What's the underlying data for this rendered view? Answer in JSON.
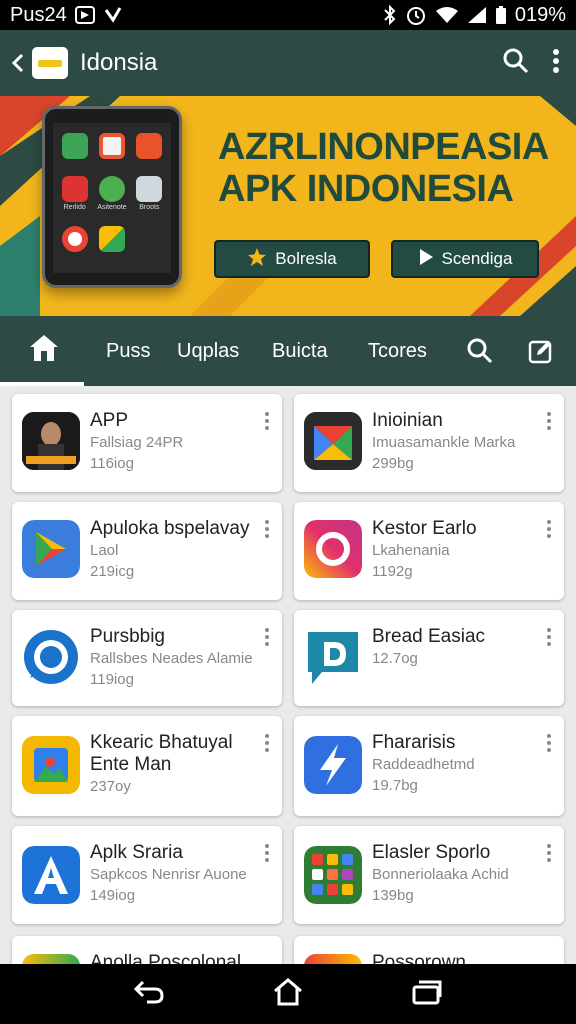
{
  "status_bar": {
    "carrier": "Pus24",
    "battery": "019%"
  },
  "app_bar": {
    "title": "Idonsia"
  },
  "banner": {
    "headline_line1": "AZRLINONPEASIA",
    "headline_line2": "APK INDONESIA",
    "button1_label": "Bolresla",
    "button2_label": "Scendiga",
    "phone_apps": [
      "",
      "",
      "",
      "Rerlido",
      "Asitenote",
      "Broots",
      "",
      "",
      ""
    ]
  },
  "tabs": [
    "Puss",
    "Uqplas",
    "Buicta",
    "Tcores"
  ],
  "apps": [
    {
      "title": "APP",
      "subtitle": "Fallsiag 24PR",
      "size": "116iog",
      "icon": "portrait-game-icon"
    },
    {
      "title": "Inioinian",
      "subtitle": "Imuasamankle Marka",
      "size": "299bg",
      "icon": "maps-icon"
    },
    {
      "title": "Apuloka bspelavay",
      "subtitle": "Laol",
      "size": "219icg",
      "icon": "play-store-icon"
    },
    {
      "title": "Kestor Earlo",
      "subtitle": "Lkahenania",
      "size": "1192g",
      "icon": "camera-ring-icon"
    },
    {
      "title": "Pursbbig",
      "subtitle": "Rallsbes Neades Alamie",
      "size": "119iog",
      "icon": "chat-bubble-icon"
    },
    {
      "title": "Bread Easiac",
      "subtitle": "",
      "size": "12.7og",
      "icon": "d-letter-icon"
    },
    {
      "title": "Kkearic Bhatuyal",
      "subtitle": "Ente Man",
      "size": "237oy",
      "icon": "photo-icon"
    },
    {
      "title": "Fhararisis",
      "subtitle": "Raddeadhetmd",
      "size": "19.7bg",
      "icon": "lightning-icon"
    },
    {
      "title": "Aplk Sraria",
      "subtitle": "Sapkcos Nenrisr Auone",
      "size": "149iog",
      "icon": "a-letter-icon"
    },
    {
      "title": "Elasler Sporlo",
      "subtitle": "Bonneriolaaka Achid",
      "size": "139bg",
      "icon": "app-grid-icon"
    },
    {
      "title": "Anolla Poscolonal",
      "subtitle": "",
      "size": "",
      "icon": "partial-icon"
    },
    {
      "title": "Possorown",
      "subtitle": "",
      "size": "",
      "icon": "partial-icon"
    }
  ],
  "colors": {
    "brand": "#2d4a44",
    "banner": "#f2b61c",
    "accent_red": "#d8452b"
  }
}
